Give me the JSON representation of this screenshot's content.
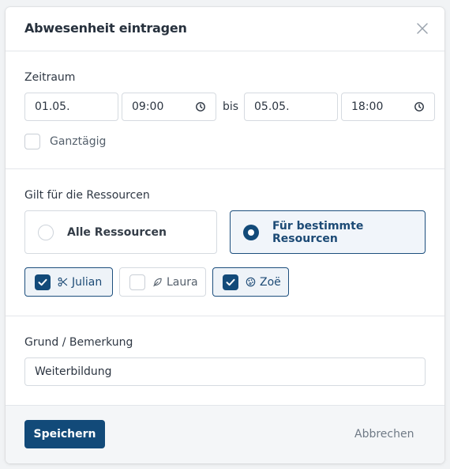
{
  "dialog": {
    "title": "Abwesenheit eintragen",
    "close_icon": "close-icon"
  },
  "period": {
    "label": "Zeitraum",
    "start_date": "01.05.",
    "start_time": "09:00",
    "separator": "bis",
    "end_date": "05.05.",
    "end_time": "18:00",
    "all_day_label": "Ganztägig",
    "all_day_checked": false
  },
  "resources": {
    "label": "Gilt für die Ressourcen",
    "options": [
      {
        "label": "Alle Ressourcen",
        "selected": false
      },
      {
        "label": "Für bestimmte Resourcen",
        "selected": true
      }
    ],
    "items": [
      {
        "name": "Julian",
        "icon": "scissors-icon",
        "checked": true
      },
      {
        "name": "Laura",
        "icon": "leaf-icon",
        "checked": false
      },
      {
        "name": "Zoë",
        "icon": "palette-icon",
        "checked": true
      }
    ]
  },
  "note": {
    "label": "Grund / Bemerkung",
    "value": "Weiterbildung"
  },
  "footer": {
    "save_label": "Speichern",
    "cancel_label": "Abbrechen"
  },
  "colors": {
    "primary": "#124a79",
    "border": "#d5dae0",
    "footer_bg": "#f4f6f8"
  }
}
